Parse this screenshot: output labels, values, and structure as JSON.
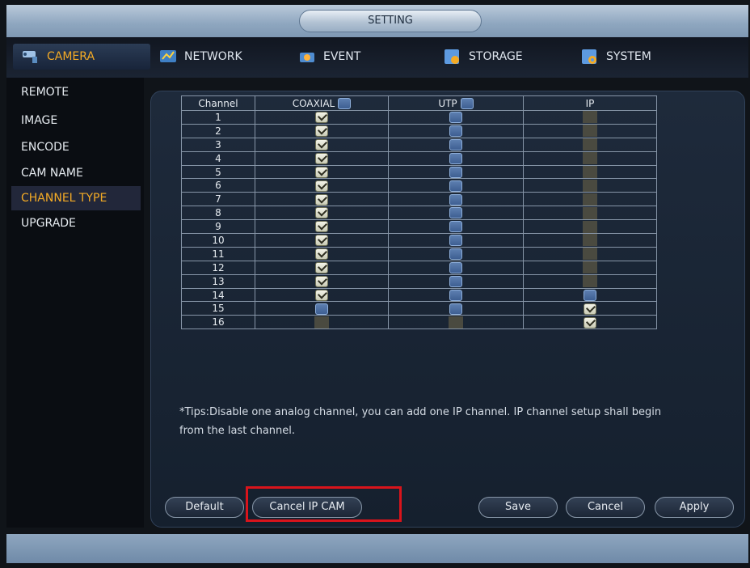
{
  "window": {
    "title": "SETTING"
  },
  "tabs": [
    {
      "label": "CAMERA",
      "icon": "camera-icon",
      "active": true
    },
    {
      "label": "NETWORK",
      "icon": "network-icon"
    },
    {
      "label": "EVENT",
      "icon": "event-icon"
    },
    {
      "label": "STORAGE",
      "icon": "storage-icon"
    },
    {
      "label": "SYSTEM",
      "icon": "system-icon"
    }
  ],
  "sidebar": {
    "items": [
      "REMOTE",
      "IMAGE",
      "ENCODE",
      "CAM NAME",
      "CHANNEL TYPE",
      "UPGRADE"
    ],
    "selected": "CHANNEL TYPE"
  },
  "table": {
    "headers": [
      "Channel",
      "COAXIAL",
      "UTP",
      "IP"
    ],
    "rows": [
      {
        "channel": "1",
        "coaxial": "on",
        "utp": "off",
        "ip": "dis"
      },
      {
        "channel": "2",
        "coaxial": "on",
        "utp": "off",
        "ip": "dis"
      },
      {
        "channel": "3",
        "coaxial": "on",
        "utp": "off",
        "ip": "dis"
      },
      {
        "channel": "4",
        "coaxial": "on",
        "utp": "off",
        "ip": "dis"
      },
      {
        "channel": "5",
        "coaxial": "on",
        "utp": "off",
        "ip": "dis"
      },
      {
        "channel": "6",
        "coaxial": "on",
        "utp": "off",
        "ip": "dis"
      },
      {
        "channel": "7",
        "coaxial": "on",
        "utp": "off",
        "ip": "dis"
      },
      {
        "channel": "8",
        "coaxial": "on",
        "utp": "off",
        "ip": "dis"
      },
      {
        "channel": "9",
        "coaxial": "on",
        "utp": "off",
        "ip": "dis"
      },
      {
        "channel": "10",
        "coaxial": "on",
        "utp": "off",
        "ip": "dis"
      },
      {
        "channel": "11",
        "coaxial": "on",
        "utp": "off",
        "ip": "dis"
      },
      {
        "channel": "12",
        "coaxial": "on",
        "utp": "off",
        "ip": "dis"
      },
      {
        "channel": "13",
        "coaxial": "on",
        "utp": "off",
        "ip": "dis"
      },
      {
        "channel": "14",
        "coaxial": "on",
        "utp": "off",
        "ip": "off"
      },
      {
        "channel": "15",
        "coaxial": "off",
        "utp": "off",
        "ip": "on"
      },
      {
        "channel": "16",
        "coaxial": "dis",
        "utp": "dis",
        "ip": "on"
      }
    ]
  },
  "tips": "*Tips:Disable one analog channel, you can add one IP channel. IP channel setup shall begin from the last channel.",
  "buttons": {
    "default": "Default",
    "cancel_ip_cam": "Cancel IP CAM",
    "save": "Save",
    "cancel": "Cancel",
    "apply": "Apply"
  },
  "colors": {
    "accent": "#f5ab25",
    "highlight": "#d9141b",
    "checkbox_off": "#4a6ea3"
  }
}
